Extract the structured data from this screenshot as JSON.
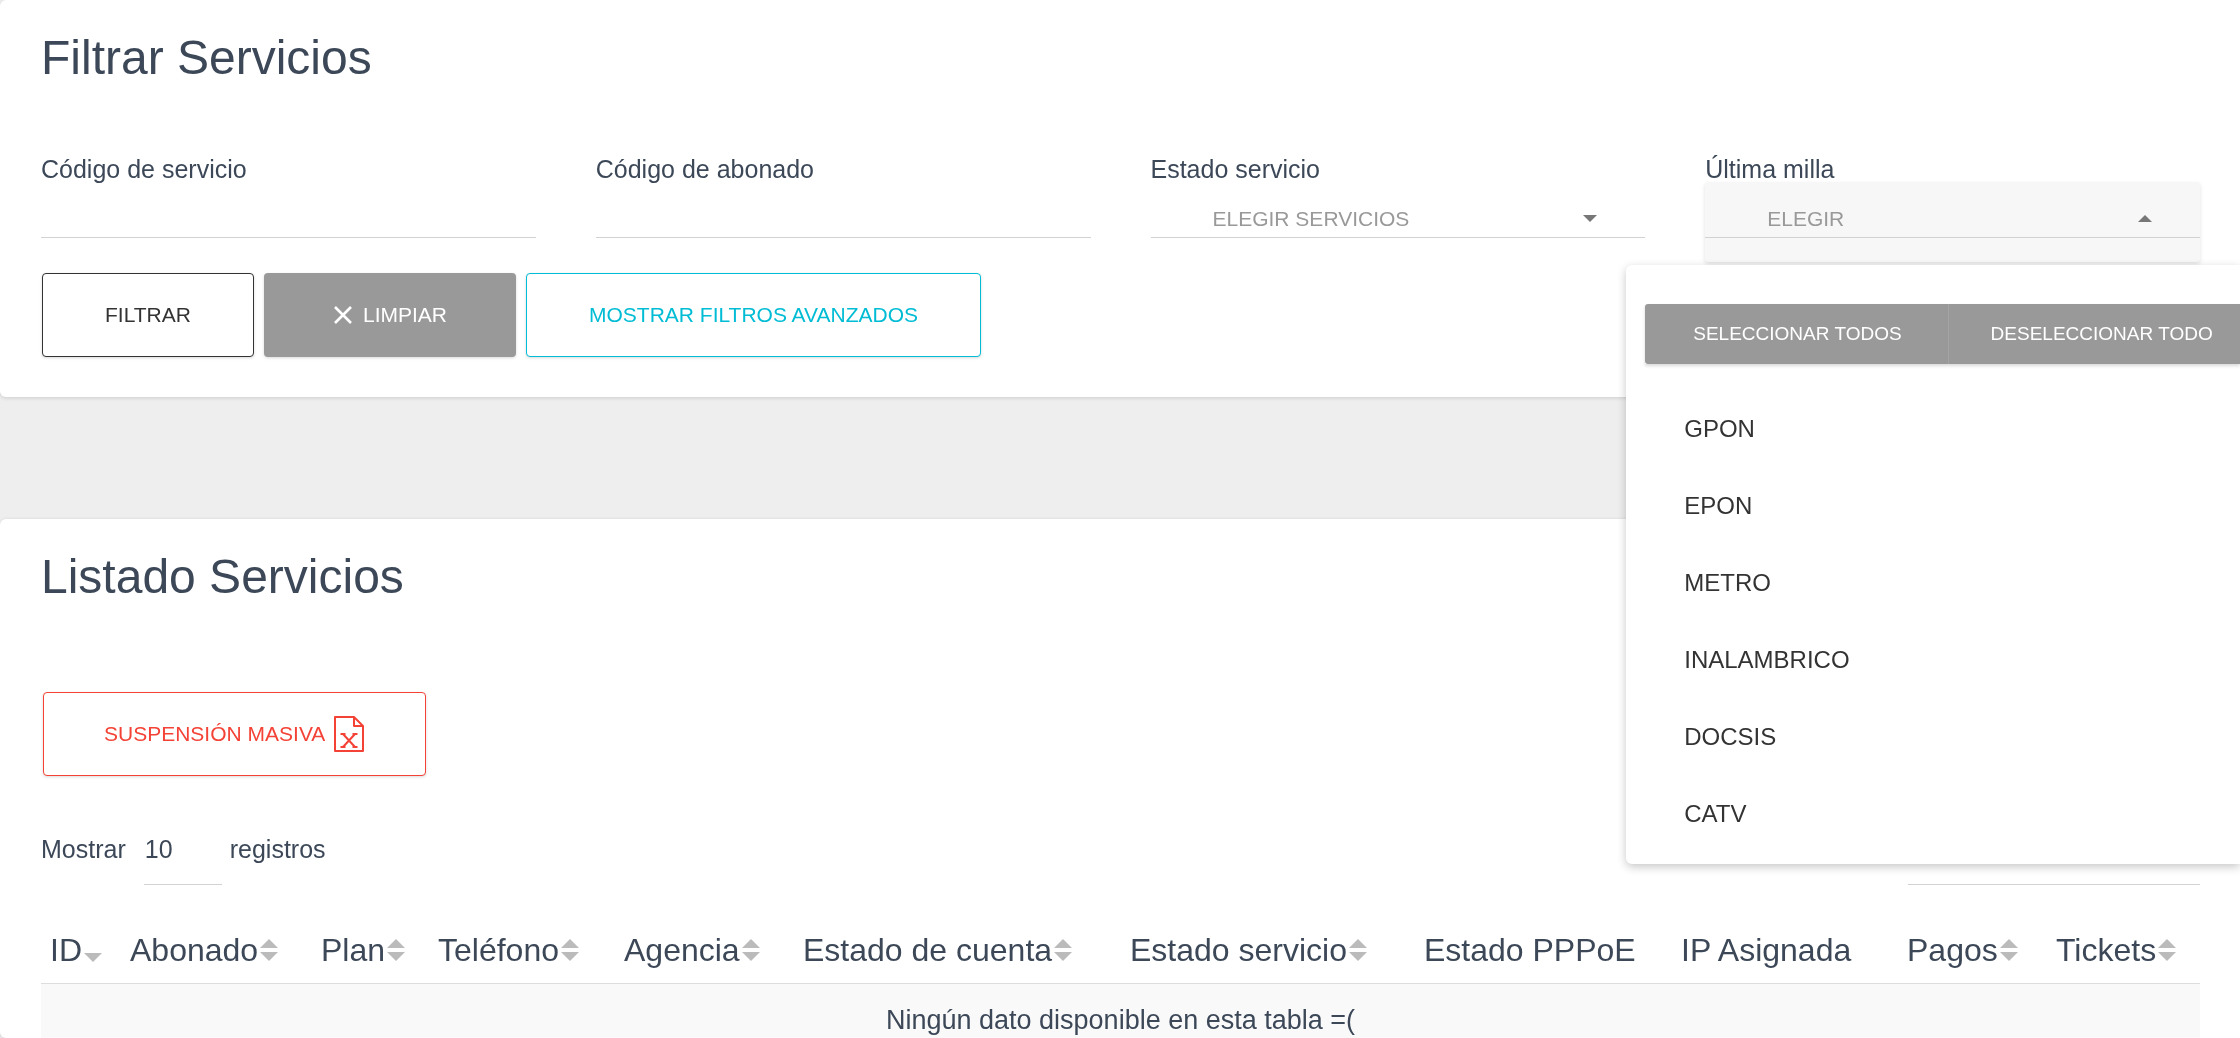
{
  "filter_card": {
    "title": "Filtrar Servicios",
    "fields": [
      {
        "kind": "text",
        "label": "Código de servicio"
      },
      {
        "kind": "text",
        "label": "Código de abonado"
      },
      {
        "kind": "select",
        "label": "Estado servicio",
        "placeholder": "ELEGIR SERVICIOS",
        "expanded": false
      },
      {
        "kind": "select",
        "label": "Última milla",
        "placeholder": "ELEGIR",
        "expanded": true,
        "menu": {
          "actions": [
            {
              "kind": "select_all",
              "label": "SELECCIONAR TODOS"
            },
            {
              "kind": "deselect_all",
              "label": "DESELECCIONAR TODO"
            }
          ],
          "options": [
            {
              "label": "GPON",
              "selected": false
            },
            {
              "label": "EPON",
              "selected": false
            },
            {
              "label": "METRO",
              "selected": false
            },
            {
              "label": "INALAMBRICO",
              "selected": false
            },
            {
              "label": "DOCSIS",
              "selected": false
            },
            {
              "label": "CATV",
              "selected": false
            }
          ]
        }
      }
    ],
    "buttons": [
      {
        "kind": "outline",
        "label": "FILTRAR"
      },
      {
        "kind": "clear",
        "label": "LIMPIAR"
      },
      {
        "kind": "info",
        "label": "MOSTRAR FILTROS AVANZADOS"
      }
    ]
  },
  "list_card": {
    "title": "Listado Servicios",
    "mass_suspension_button": "SUSPENSIÓN MASIVA",
    "page_length": {
      "label_before": "Mostrar",
      "value": "10",
      "label_after": "registros"
    },
    "table": {
      "columns": [
        {
          "label": "ID",
          "sortable": true,
          "sorted": true
        },
        {
          "label": "Abonado",
          "sortable": true,
          "sorted": false
        },
        {
          "label": "Plan",
          "sortable": true,
          "sorted": false
        },
        {
          "label": "Teléfono",
          "sortable": true,
          "sorted": false
        },
        {
          "label": "Agencia",
          "sortable": true,
          "sorted": false
        },
        {
          "label": "Estado de cuenta",
          "sortable": true,
          "sorted": false
        },
        {
          "label": "Estado servicio",
          "sortable": true,
          "sorted": false
        },
        {
          "label": "Estado PPPoE",
          "sortable": false,
          "sorted": false
        },
        {
          "label": "IP Asignada",
          "sortable": false,
          "sorted": false
        },
        {
          "label": "Pagos",
          "sortable": true,
          "sorted": false
        },
        {
          "label": "Tickets",
          "sortable": true,
          "sorted": false
        }
      ],
      "empty_message": "Ningún dato disponible en esta tabla =("
    }
  }
}
